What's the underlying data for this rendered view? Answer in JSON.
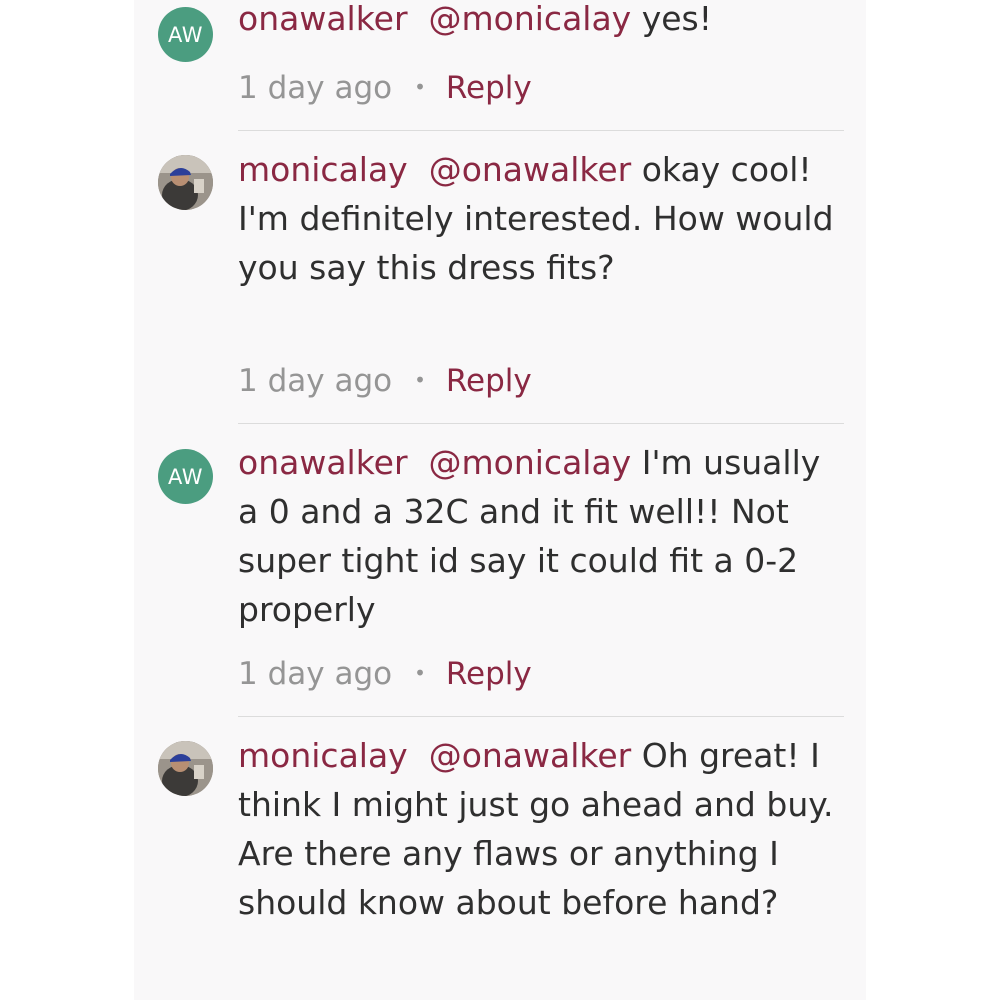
{
  "comments": [
    {
      "avatar_initials": "AW",
      "author": "onawalker",
      "mention": "@monicalay",
      "text": "yes!",
      "time": "1 day ago",
      "separator": "•",
      "reply_label": "Reply"
    },
    {
      "avatar_initials": "",
      "author": "monicalay",
      "mention": "@onawalker",
      "text": "okay cool! I'm definitely interested. How would you say this dress fits?",
      "time": "1 day ago",
      "separator": "•",
      "reply_label": "Reply"
    },
    {
      "avatar_initials": "AW",
      "author": "onawalker",
      "mention": "@monicalay",
      "text": "I'm usually a 0 and a 32C and it fit well!! Not super tight id say it could fit a 0-2 properly",
      "time": "1 day ago",
      "separator": "•",
      "reply_label": "Reply"
    },
    {
      "avatar_initials": "",
      "author": "monicalay",
      "mention": "@onawalker",
      "text": "Oh great! I think I might just go ahead and buy. Are there any flaws or anything I should know about before hand?",
      "time": "1 day ago",
      "separator": "•",
      "reply_label": "Reply"
    }
  ],
  "colors": {
    "accent": "#8a2843",
    "avatar_green": "#4b9d80",
    "body_text": "#2f2f2f",
    "meta_text": "#959595",
    "panel_bg": "#f9f8f9"
  }
}
